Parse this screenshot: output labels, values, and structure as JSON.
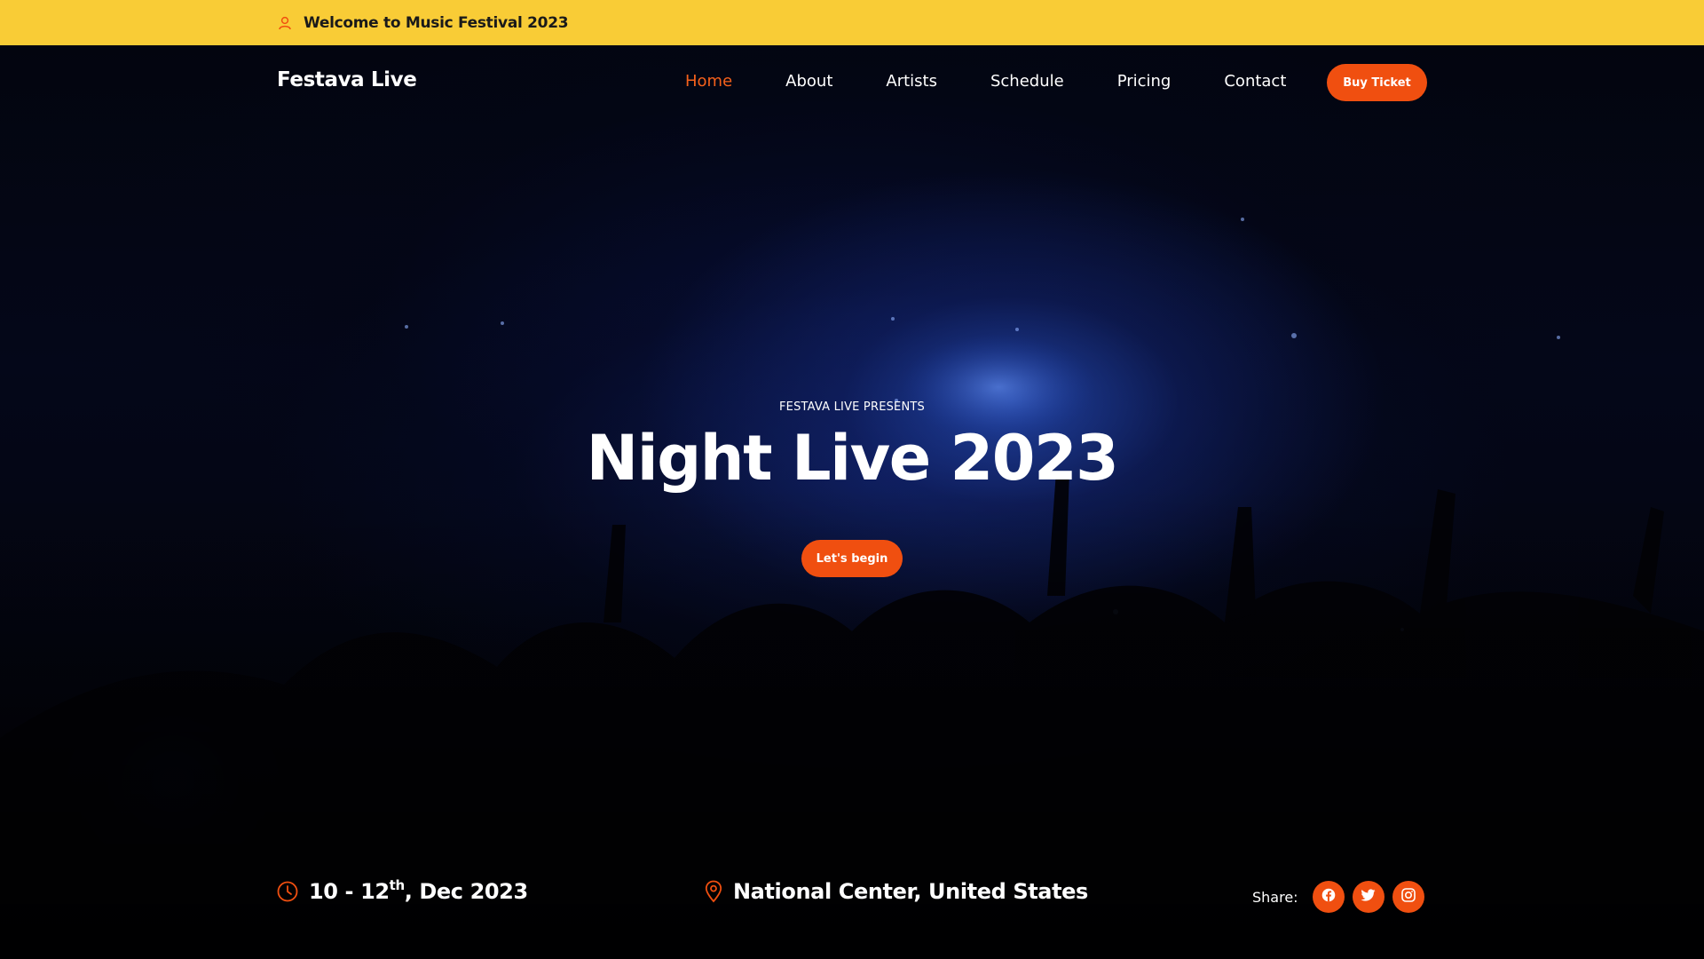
{
  "topbar": {
    "icon": "person-icon",
    "text": "Welcome to Music Festival 2023"
  },
  "nav": {
    "brand": "Festava Live",
    "links": [
      "Home",
      "About",
      "Artists",
      "Schedule",
      "Pricing",
      "Contact"
    ],
    "active": "Home",
    "buy_ticket": "Buy Ticket"
  },
  "hero": {
    "eyebrow": "FESTAVA LIVE PRESENTS",
    "title": "Night Live 2023",
    "cta": "Let's begin"
  },
  "info": {
    "date_prefix": "10 - 12",
    "date_sup": "th",
    "date_suffix": ", Dec 2023",
    "location": "National Center, United States"
  },
  "share": {
    "label": "Share:",
    "icons": [
      "facebook-icon",
      "twitter-icon",
      "instagram-icon"
    ]
  },
  "colors": {
    "accent": "#f04f10",
    "topbar": "#f9cc36",
    "active_link": "#f5611b"
  }
}
